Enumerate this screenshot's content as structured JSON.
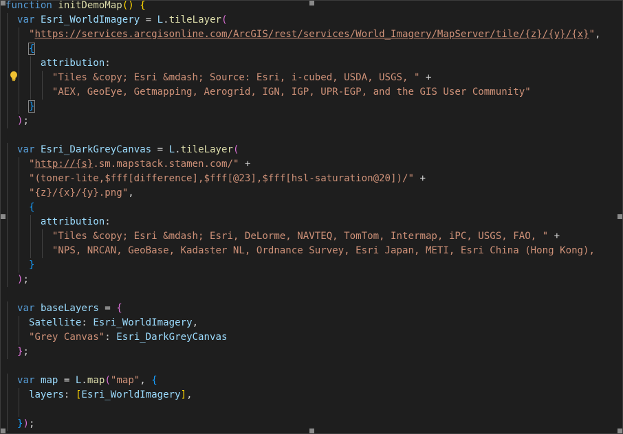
{
  "editor": {
    "lightbulb_icon": "lightbulb-icon",
    "resize_handle_icon": "resize-handle-icon",
    "lines": [
      [
        [
          "kw",
          "function"
        ],
        [
          "pl",
          " "
        ],
        [
          "fn",
          "initDemoMap"
        ],
        [
          "b1",
          "()"
        ],
        [
          "pl",
          " "
        ],
        [
          "b1",
          "{"
        ]
      ],
      [
        [
          "kw",
          "var"
        ],
        [
          "pl",
          " "
        ],
        [
          "id",
          "Esri_WorldImagery"
        ],
        [
          "pl",
          " = "
        ],
        [
          "id",
          "L"
        ],
        [
          "pl",
          "."
        ],
        [
          "fn",
          "tileLayer"
        ],
        [
          "b2",
          "("
        ]
      ],
      [
        [
          "str",
          "\""
        ],
        [
          "str-link",
          "https://services.arcgisonline.com/ArcGIS/rest/services/World_Imagery/MapServer/tile/{z}/{y}/{x}"
        ],
        [
          "str",
          "\""
        ],
        [
          "pl",
          ","
        ]
      ],
      [
        [
          "b3-match",
          "{"
        ]
      ],
      [
        [
          "id",
          "attribution"
        ],
        [
          "pl",
          ":"
        ]
      ],
      [
        [
          "str",
          "\"Tiles &copy; Esri &mdash; Source: Esri, i-cubed, USDA, USGS, \""
        ],
        [
          "pl",
          " +"
        ]
      ],
      [
        [
          "str",
          "\"AEX, GeoEye, Getmapping, Aerogrid, IGN, IGP, UPR-EGP, and the GIS User Community\""
        ]
      ],
      [
        [
          "b3-match",
          "}"
        ]
      ],
      [
        [
          "b2",
          ")"
        ],
        [
          "pl",
          ";"
        ]
      ],
      [],
      [
        [
          "kw",
          "var"
        ],
        [
          "pl",
          " "
        ],
        [
          "id",
          "Esri_DarkGreyCanvas"
        ],
        [
          "pl",
          " = "
        ],
        [
          "id",
          "L"
        ],
        [
          "pl",
          "."
        ],
        [
          "fn",
          "tileLayer"
        ],
        [
          "b2",
          "("
        ]
      ],
      [
        [
          "str",
          "\""
        ],
        [
          "str-link",
          "http://{s}"
        ],
        [
          "str",
          ".sm.mapstack.stamen.com/\""
        ],
        [
          "pl",
          " +"
        ]
      ],
      [
        [
          "str",
          "\"(toner-lite,$fff[difference],$fff[@23],$fff[hsl-saturation@20])/\""
        ],
        [
          "pl",
          " +"
        ]
      ],
      [
        [
          "str",
          "\"{z}/{x}/{y}.png\""
        ],
        [
          "pl",
          ","
        ]
      ],
      [
        [
          "b3",
          "{"
        ]
      ],
      [
        [
          "id",
          "attribution"
        ],
        [
          "pl",
          ":"
        ]
      ],
      [
        [
          "str",
          "\"Tiles &copy; Esri &mdash; Esri, DeLorme, NAVTEQ, TomTom, Intermap, iPC, USGS, FAO, \""
        ],
        [
          "pl",
          " +"
        ]
      ],
      [
        [
          "str",
          "\"NPS, NRCAN, GeoBase, Kadaster NL, Ordnance Survey, Esri Japan, METI, Esri China (Hong Kong),"
        ]
      ],
      [
        [
          "b3",
          "}"
        ]
      ],
      [
        [
          "b2",
          ")"
        ],
        [
          "pl",
          ";"
        ]
      ],
      [],
      [
        [
          "kw",
          "var"
        ],
        [
          "pl",
          " "
        ],
        [
          "id",
          "baseLayers"
        ],
        [
          "pl",
          " = "
        ],
        [
          "b2",
          "{"
        ]
      ],
      [
        [
          "id",
          "Satellite"
        ],
        [
          "pl",
          ": "
        ],
        [
          "id",
          "Esri_WorldImagery"
        ],
        [
          "pl",
          ","
        ]
      ],
      [
        [
          "str",
          "\"Grey Canvas\""
        ],
        [
          "pl",
          ": "
        ],
        [
          "id",
          "Esri_DarkGreyCanvas"
        ]
      ],
      [
        [
          "b2",
          "}"
        ],
        [
          "pl",
          ";"
        ]
      ],
      [],
      [
        [
          "kw",
          "var"
        ],
        [
          "pl",
          " "
        ],
        [
          "id",
          "map"
        ],
        [
          "pl",
          " = "
        ],
        [
          "id",
          "L"
        ],
        [
          "pl",
          "."
        ],
        [
          "fn",
          "map"
        ],
        [
          "b2",
          "("
        ],
        [
          "str",
          "\"map\""
        ],
        [
          "pl",
          ", "
        ],
        [
          "b3",
          "{"
        ]
      ],
      [
        [
          "id",
          "layers"
        ],
        [
          "pl",
          ": "
        ],
        [
          "b1",
          "["
        ],
        [
          "id",
          "Esri_WorldImagery"
        ],
        [
          "b1",
          "]"
        ],
        [
          "pl",
          ","
        ]
      ],
      [],
      [
        [
          "b3",
          "}"
        ],
        [
          "b2",
          ")"
        ],
        [
          "pl",
          ";"
        ]
      ]
    ]
  }
}
